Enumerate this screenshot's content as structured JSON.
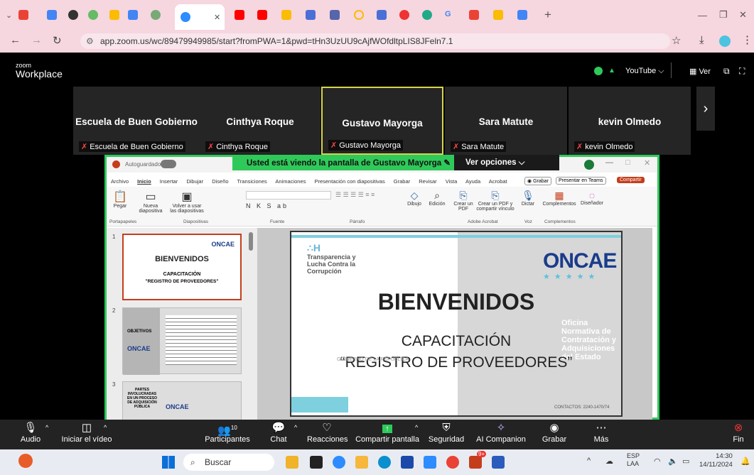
{
  "browser": {
    "url": "app.zoom.us/wc/89479949985/start?fromPWA=1&pwd=tHn3UzUU9cAjfWOfdltpLIS8JFeln7.1",
    "new_tab": "+",
    "window_controls": [
      "—",
      "❐",
      "✕"
    ]
  },
  "zoom": {
    "logo_top": "zoom",
    "logo_bottom": "Workplace",
    "youtube": "YouTube",
    "view": "Ver",
    "participants": [
      {
        "name": "Escuela de Buen Gobierno",
        "label": "Escuela de Buen Gobierno"
      },
      {
        "name": "Cinthya Roque",
        "label": "Cinthya Roque"
      },
      {
        "name": "Gustavo Mayorga",
        "label": "Gustavo Mayorga"
      },
      {
        "name": "Sara Matute",
        "label": "Sara Matute"
      },
      {
        "name": "kevin Olmedo",
        "label": "kevin Olmedo"
      }
    ],
    "share_banner": "Usted está viendo la pantalla de",
    "share_banner_name": "Gustavo Mayorga",
    "view_options": "Ver opciones",
    "toolbar": {
      "audio": "Audio",
      "video": "Iniciar el vídeo",
      "participants": "Participantes",
      "participants_count": "10",
      "chat": "Chat",
      "reactions": "Reacciones",
      "share": "Compartir pantalla",
      "security": "Seguridad",
      "companion": "AI Companion",
      "record": "Grabar",
      "more": "Más",
      "end": "Fin"
    }
  },
  "ppt": {
    "autosave": "Autoguardado",
    "menu": [
      "Archivo",
      "Inicio",
      "Insertar",
      "Dibujar",
      "Diseño",
      "Transiciones",
      "Animaciones",
      "Presentación con diapositivas",
      "Grabar",
      "Revisar",
      "Vista",
      "Ayuda",
      "Acrobat"
    ],
    "record_btn": "Grabar",
    "teams_btn": "Presentar en Teams",
    "share_btn": "Compartir",
    "groups": [
      "Portapapeles",
      "Diapositivas",
      "Fuente",
      "Párrafo",
      "Adobe Acrobat",
      "Voz",
      "Complementos"
    ],
    "ribbon": {
      "paste": "Pegar",
      "new_slide": "Nueva diapositiva",
      "reuse": "Volver a usar las diapositivas",
      "draw": "Dibujo",
      "edit": "Edición",
      "create_pdf": "Crear un PDF",
      "share_pdf": "Crear un PDF y compartir vínculo",
      "dictate": "Dictar",
      "addins": "Complementos",
      "designer": "Diseñador"
    },
    "slide_numbers": [
      "1",
      "2",
      "3"
    ],
    "thumb1": {
      "title": "BIENVENIDOS",
      "sub": "CAPACITACIÓN",
      "sub2": "\"REGISTRO DE PROVEEDORES\""
    },
    "thumb2": {
      "title": "OBJETIVOS"
    },
    "thumb3": {
      "title": "PARTES INVOLUCRADAS EN UN PROCESO DE ADQUISICIÓN PÚBLICA"
    },
    "slide": {
      "org1": "Transparencia y",
      "org2": "Lucha Contra la",
      "org3": "Corrupción",
      "logo": "ONCAE",
      "title": "BIENVENIDOS",
      "sub": "CAPACITACIÓN",
      "sub2": "“REGISTRO DE PROVEEDORES”",
      "watermark1": "Oficina Normativa de",
      "watermark2": "Contratación y Adquisiciones",
      "watermark3": "del Estado",
      "gov": "GOBIERNO DE LA REPÚBLICA",
      "footer": "CONTACTOS: 2240-1470/74"
    }
  },
  "taskbar": {
    "search": "Buscar",
    "lang1": "ESP",
    "lang2": "LAA",
    "time": "14:30",
    "date": "14/11/2024",
    "notif": "9+"
  }
}
